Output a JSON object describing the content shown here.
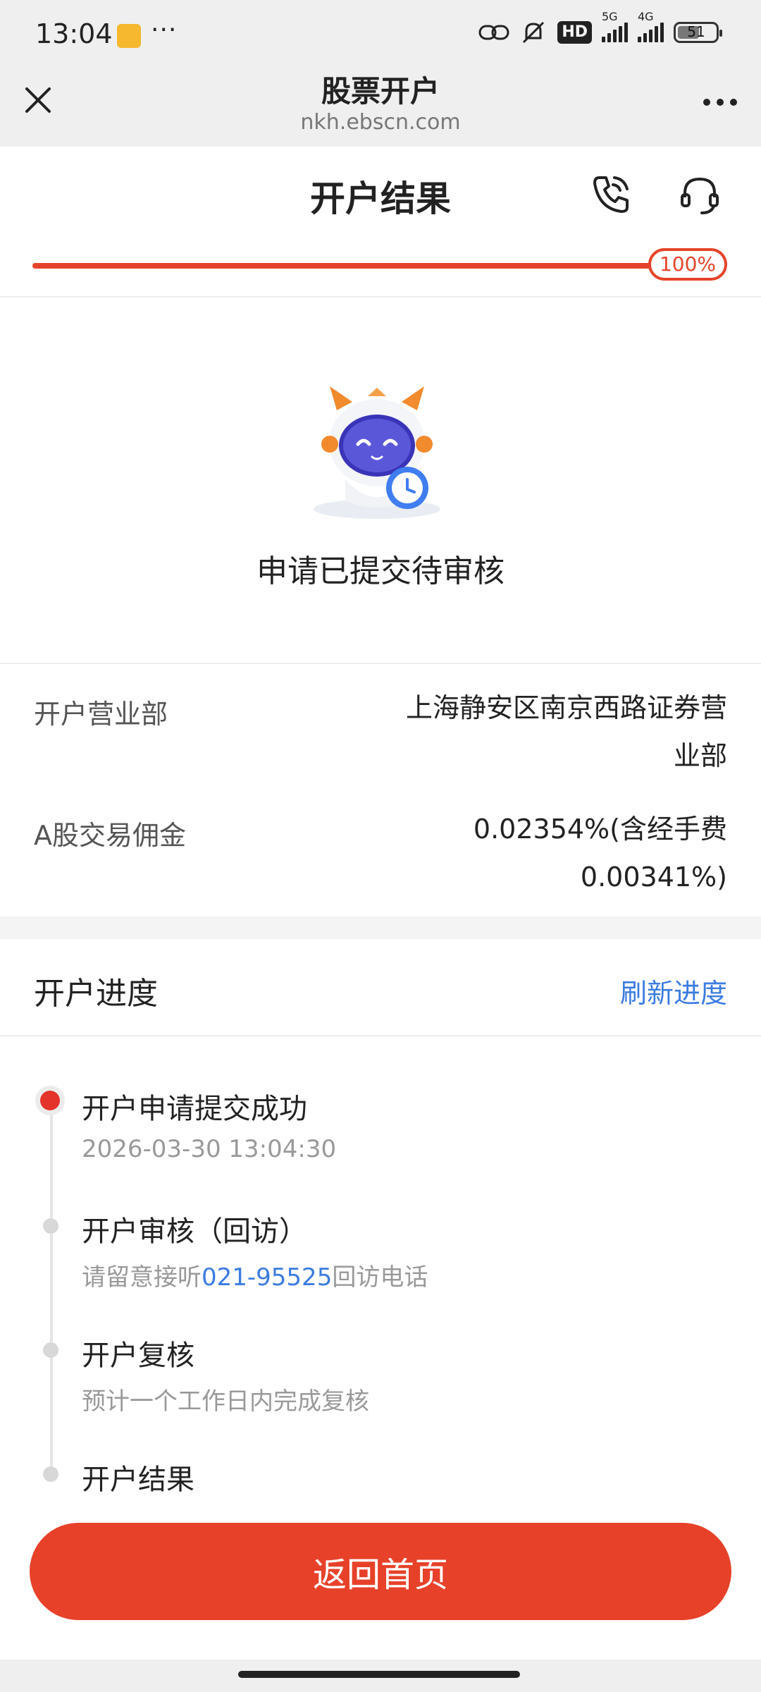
{
  "status_bar": {
    "time": "13:04",
    "more": "···",
    "hd": "HD",
    "net1": "5G",
    "net2": "4G",
    "battery": "51"
  },
  "browser": {
    "title": "股票开户",
    "url": "nkh.ebscn.com"
  },
  "header": {
    "title": "开户结果"
  },
  "progress": {
    "percent_label": "100%",
    "value": 1.0
  },
  "result": {
    "status_text": "申请已提交待审核"
  },
  "info": {
    "branch_label": "开户营业部",
    "branch_value_line1": "上海静安区南京西路证券营",
    "branch_value_line2": "业部",
    "commission_label": "A股交易佣金",
    "commission_value_line1": "0.02354%(含经手费",
    "commission_value_line2": "0.00341%)"
  },
  "progress_section": {
    "title": "开户进度",
    "refresh_label": "刷新进度"
  },
  "steps": [
    {
      "title": "开户申请提交成功",
      "sub": "2026-03-30 13:04:30"
    },
    {
      "title": "开户审核（回访）",
      "sub_prefix": "请留意接听",
      "sub_phone": "021-95525",
      "sub_suffix": "回访电话"
    },
    {
      "title": "开户复核",
      "sub": "预计一个工作日内完成复核"
    },
    {
      "title": "开户结果"
    }
  ],
  "buttons": {
    "home": "返回首页"
  },
  "colors": {
    "accent": "#e7412a",
    "link": "#3b7be0"
  }
}
